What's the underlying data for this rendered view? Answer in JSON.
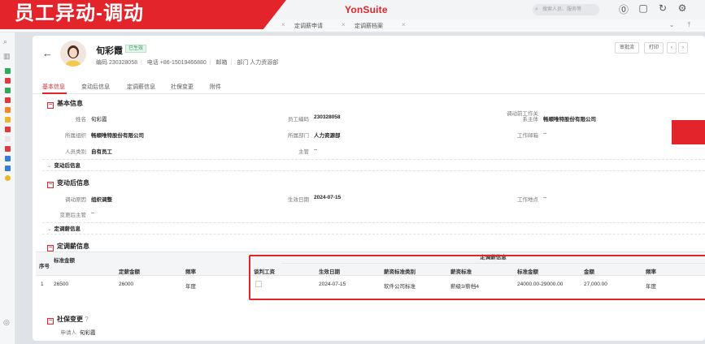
{
  "banner": {
    "title": "员工异动-调动"
  },
  "topbar": {
    "brand": "YonSuite",
    "search_placeholder": "搜索人员、服务等"
  },
  "tabs": [
    {
      "label": "定调薪申请"
    },
    {
      "label": "定调薪档案"
    }
  ],
  "header": {
    "name": "旬彩霞",
    "status": "已生效",
    "meta": {
      "code_label": "编码",
      "code": "230328058",
      "phone_label": "电话",
      "phone": "+86-15019466880",
      "email_label": "邮箱",
      "dept_label": "部门",
      "dept": "人力资源部"
    },
    "buttons": {
      "approve": "审批流",
      "print": "打印"
    }
  },
  "subtabs": [
    "基本信息",
    "变动后信息",
    "定调薪信息",
    "社保变更",
    "附件"
  ],
  "basic": {
    "title": "基本信息",
    "fields": {
      "name_label": "姓名",
      "name_value": "旬彩霞",
      "emp_code_label": "员工编码",
      "emp_code_value": "230328058",
      "pre_entity_label_1": "调动前工作关",
      "pre_entity_label_2": "系主体",
      "pre_entity_value": "畅顺唯特股份有限公司",
      "org_label": "所属组织",
      "org_value": "畅顺唯特股份有限公司",
      "dept_label": "所属部门",
      "dept_value": "人力资源部",
      "email_label": "工作邮箱",
      "email_value": "--",
      "type_label": "人员类别",
      "type_value": "自有员工",
      "manager_label": "主管",
      "manager_value": "--"
    }
  },
  "after_change_sub": "变动后信息",
  "after": {
    "title": "变动后信息",
    "reason_label": "调动原因",
    "reason_value": "组织调整",
    "effective_label": "生效日期",
    "effective_value": "2024-07-15",
    "location_label": "工作地点",
    "location_value": "--",
    "manager_label": "变更后主管",
    "manager_value": "--"
  },
  "salary_sub": "定调薪信息",
  "salary": {
    "title": "定调薪信息",
    "group_title": "定调薪信息",
    "columns": {
      "seq": "序号",
      "std_amount": "标准金额",
      "fixed_amount": "定薪金额",
      "freq": "频率",
      "negotiate": "谈判工资",
      "effective": "生效日期",
      "std_category": "薪资标准类别",
      "std": "薪资标准",
      "std_amount2": "标准金额",
      "amount": "金额",
      "freq2": "频率"
    },
    "rows": [
      {
        "seq": "1",
        "std_amount": "26500",
        "fixed_amount": "26000",
        "freq": "年度",
        "effective": "2024-07-15",
        "std_category": "软件公司标准",
        "std": "薪级3/薪档4",
        "std_amount2": "24000.00-29000.00",
        "amount": "27,000.00",
        "freq2": "年度"
      }
    ]
  },
  "social": {
    "title": "社保变更",
    "applicant_label": "申请人",
    "applicant_value": "旬彩霞"
  },
  "colors": {
    "accent": "#e3242b",
    "success": "#2f9e5a"
  }
}
